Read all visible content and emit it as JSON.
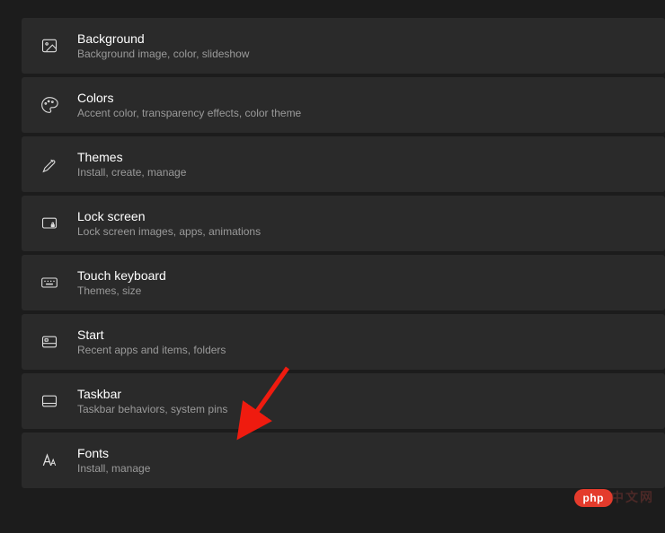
{
  "settings": [
    {
      "title": "Background",
      "desc": "Background image, color, slideshow"
    },
    {
      "title": "Colors",
      "desc": "Accent color, transparency effects, color theme"
    },
    {
      "title": "Themes",
      "desc": "Install, create, manage"
    },
    {
      "title": "Lock screen",
      "desc": "Lock screen images, apps, animations"
    },
    {
      "title": "Touch keyboard",
      "desc": "Themes, size"
    },
    {
      "title": "Start",
      "desc": "Recent apps and items, folders"
    },
    {
      "title": "Taskbar",
      "desc": "Taskbar behaviors, system pins"
    },
    {
      "title": "Fonts",
      "desc": "Install, manage"
    }
  ],
  "watermark": {
    "brand": "php",
    "suffix": "中文网"
  }
}
